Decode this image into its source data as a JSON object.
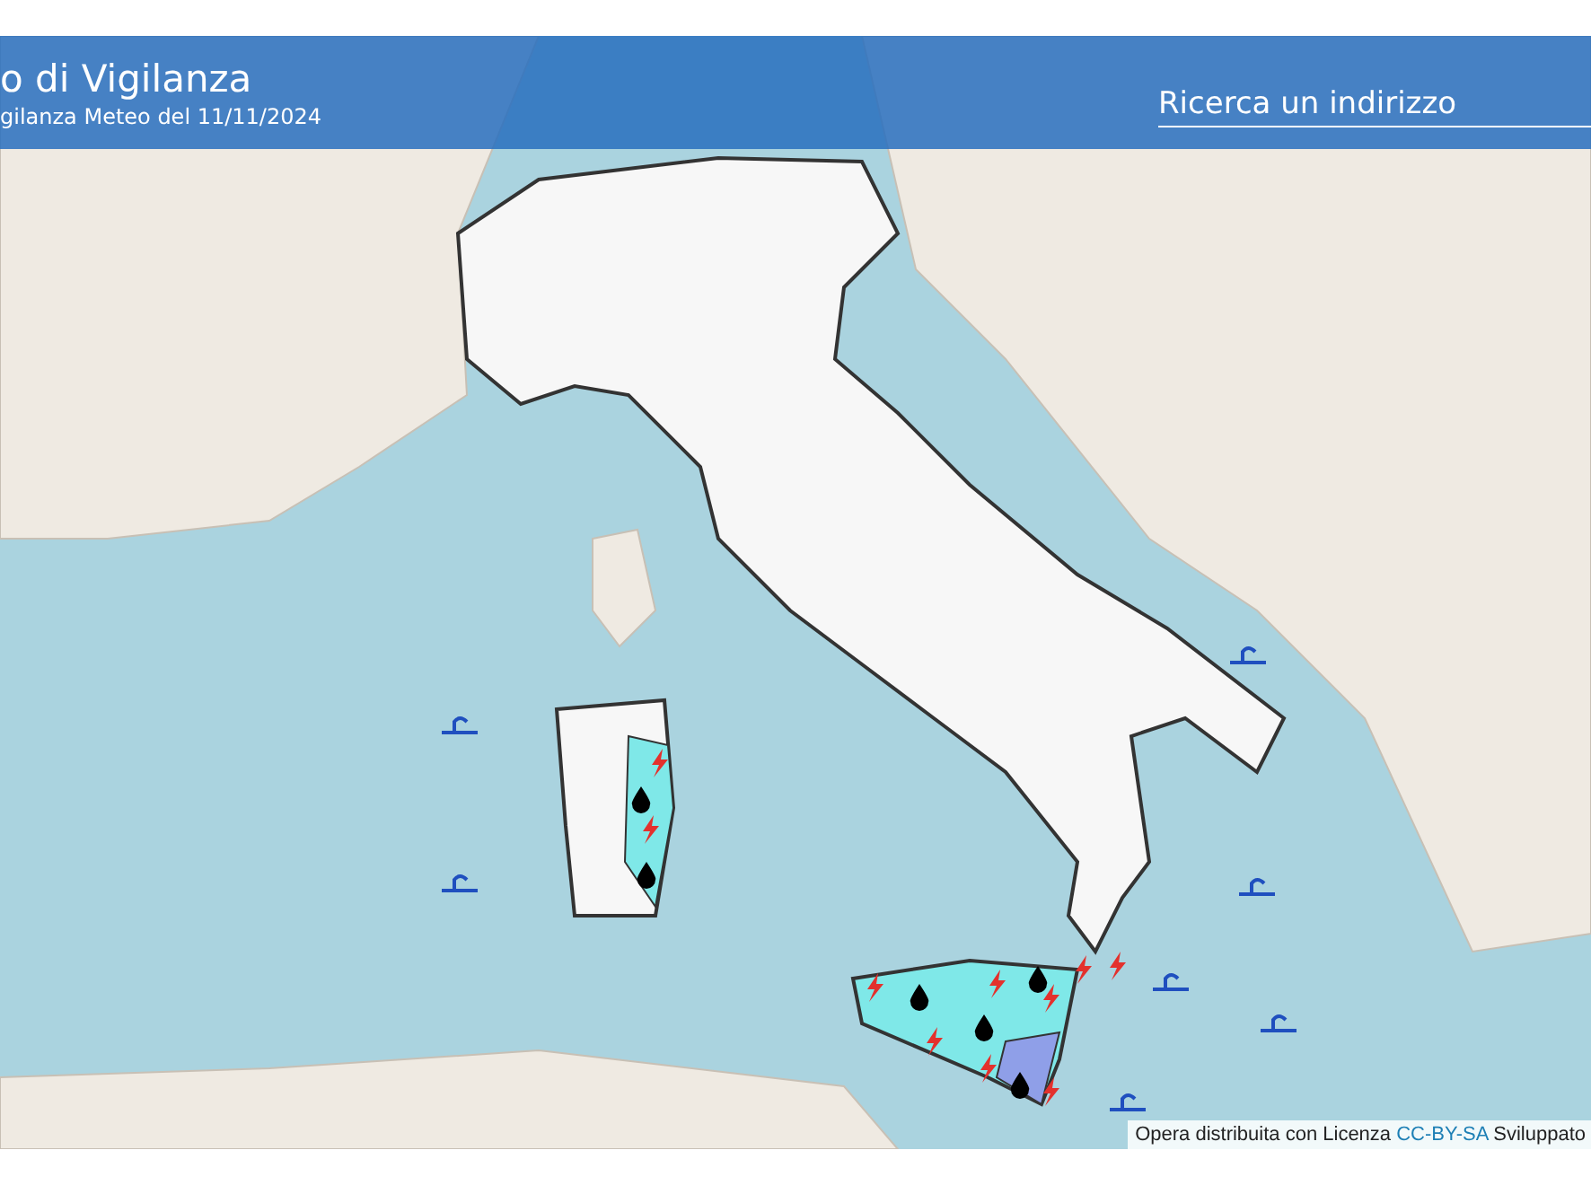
{
  "header": {
    "title": "o di Vigilanza",
    "subtitle": "gilanza Meteo del 11/11/2024"
  },
  "search": {
    "placeholder": "Ricerca un indirizzo"
  },
  "attribution": {
    "text_before": "Opera distribuita con Licenza",
    "link": "CC-BY-SA",
    "text_after": "Sviluppato"
  }
}
